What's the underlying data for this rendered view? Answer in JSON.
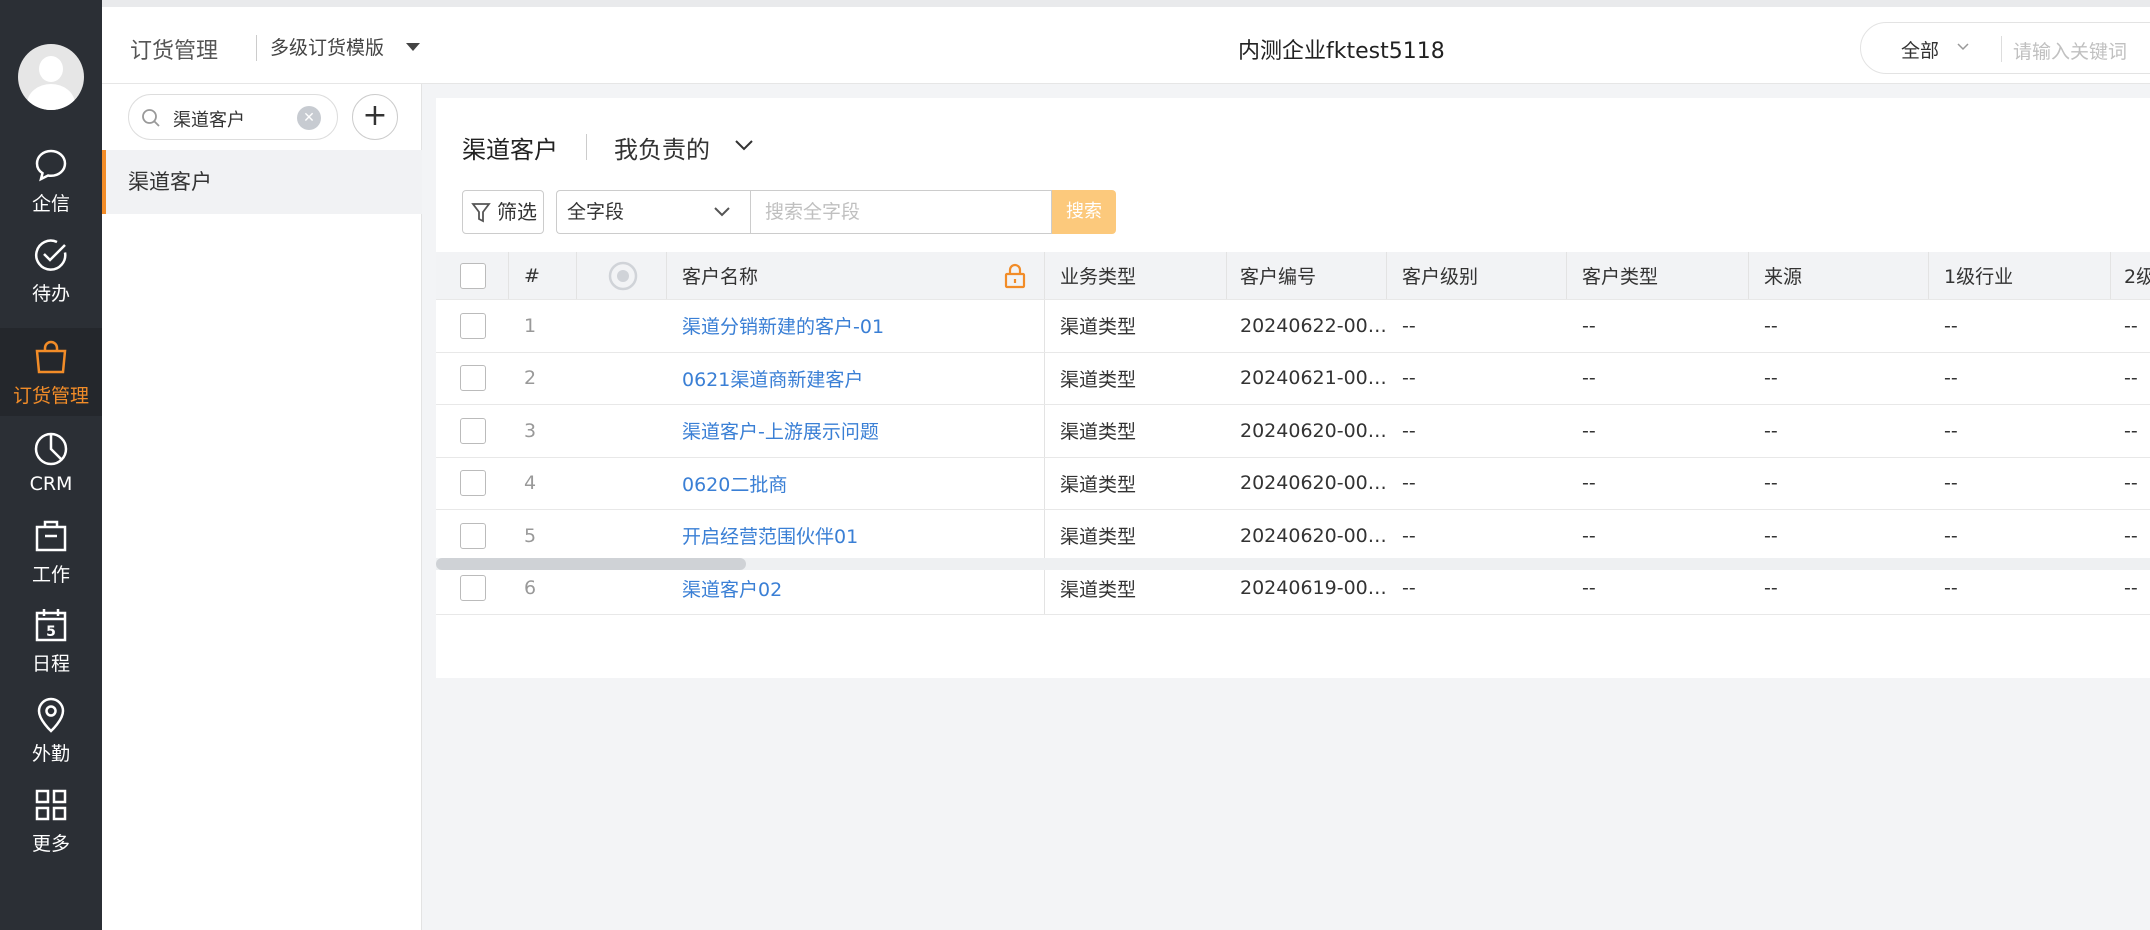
{
  "rail": {
    "items": [
      {
        "label": "企信",
        "icon": "chat-bubble-icon"
      },
      {
        "label": "待办",
        "icon": "check-circle-icon"
      },
      {
        "label": "订货管理",
        "icon": "shopping-bag-icon",
        "active": true
      },
      {
        "label": "CRM",
        "icon": "pie-chart-icon"
      },
      {
        "label": "工作",
        "icon": "briefcase-icon"
      },
      {
        "label": "日程",
        "icon": "calendar-icon",
        "day": "5"
      },
      {
        "label": "外勤",
        "icon": "location-pin-icon"
      },
      {
        "label": "更多",
        "icon": "grid-icon"
      }
    ]
  },
  "topbar": {
    "title": "订货管理",
    "template": "多级订货模版",
    "company": "内测企业fktest5118",
    "scope": "全部",
    "search_placeholder": "请输入关键词"
  },
  "sidebar": {
    "search_value": "渠道客户",
    "clear_glyph": "✕",
    "add_glyph": "+",
    "items": [
      {
        "label": "渠道客户",
        "active": true
      }
    ]
  },
  "main": {
    "title": "渠道客户",
    "view": "我负责的",
    "filter_label": "筛选",
    "field_select": "全字段",
    "search_placeholder": "搜索全字段",
    "search_button": "搜索",
    "columns": [
      "#",
      "客户名称",
      "业务类型",
      "客户编号",
      "客户级别",
      "客户类型",
      "来源",
      "1级行业",
      "2级"
    ],
    "rows": [
      {
        "idx": "1",
        "name": "渠道分销新建的客户-01",
        "biz": "渠道类型",
        "code": "20240622-00…",
        "level": "--",
        "type": "--",
        "source": "--",
        "ind1": "--",
        "ind2": "--"
      },
      {
        "idx": "2",
        "name": "0621渠道商新建客户",
        "biz": "渠道类型",
        "code": "20240621-00…",
        "level": "--",
        "type": "--",
        "source": "--",
        "ind1": "--",
        "ind2": "--"
      },
      {
        "idx": "3",
        "name": "渠道客户-上游展示问题",
        "biz": "渠道类型",
        "code": "20240620-00…",
        "level": "--",
        "type": "--",
        "source": "--",
        "ind1": "--",
        "ind2": "--"
      },
      {
        "idx": "4",
        "name": "0620二批商",
        "biz": "渠道类型",
        "code": "20240620-00…",
        "level": "--",
        "type": "--",
        "source": "--",
        "ind1": "--",
        "ind2": "--"
      },
      {
        "idx": "5",
        "name": "开启经营范围伙伴01",
        "biz": "渠道类型",
        "code": "20240620-00…",
        "level": "--",
        "type": "--",
        "source": "--",
        "ind1": "--",
        "ind2": "--"
      },
      {
        "idx": "6",
        "name": "渠道客户02",
        "biz": "渠道类型",
        "code": "20240619-00…",
        "level": "--",
        "type": "--",
        "source": "--",
        "ind1": "--",
        "ind2": "--"
      }
    ]
  },
  "colors": {
    "accent": "#f28c28",
    "link": "#3a7fd5",
    "rail_bg": "#2b2f35",
    "search_button": "#fcc97c"
  }
}
